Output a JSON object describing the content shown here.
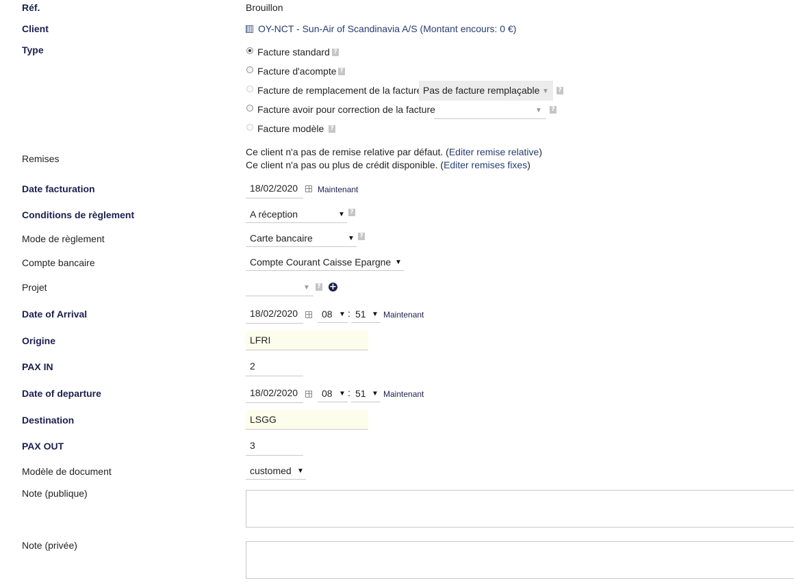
{
  "ref": {
    "label": "Réf.",
    "value": "Brouillon"
  },
  "client": {
    "label": "Client",
    "value": "OY-NCT - Sun-Air of Scandinavia A/S (Montant encours: 0 €)",
    "icon": "building-icon"
  },
  "type": {
    "label": "Type",
    "options": [
      {
        "label": "Facture standard",
        "selected": true
      },
      {
        "label": "Facture d'acompte"
      },
      {
        "label": "Facture de remplacement de la facture",
        "select_value": "Pas de facture remplaçable"
      },
      {
        "label": "Facture avoir pour correction de la facture",
        "select_value": ""
      },
      {
        "label": "Facture modèle"
      }
    ]
  },
  "remises": {
    "label": "Remises",
    "line1_text": "Ce client n'a pas de remise relative par défaut. (",
    "line1_link": "Editer remise relative",
    "line1_end": ")",
    "line2_text": "Ce client n'a pas ou plus de crédit disponible. (",
    "line2_link": "Editer remises fixes",
    "line2_end": ")"
  },
  "date_facturation": {
    "label": "Date facturation",
    "value": "18/02/2020",
    "now": "Maintenant"
  },
  "conditions": {
    "label": "Conditions de règlement",
    "value": "A réception"
  },
  "mode": {
    "label": "Mode de règlement",
    "value": "Carte bancaire"
  },
  "compte": {
    "label": "Compte bancaire",
    "value": "Compte Courant Caisse Epargne"
  },
  "projet": {
    "label": "Projet",
    "value": ""
  },
  "arrival": {
    "label": "Date of Arrival",
    "date": "18/02/2020",
    "hour": "08",
    "minute": "51",
    "sep": ":",
    "now": "Maintenant"
  },
  "origine": {
    "label": "Origine",
    "value": "LFRI"
  },
  "pax_in": {
    "label": "PAX IN",
    "value": "2"
  },
  "departure": {
    "label": "Date of departure",
    "date": "18/02/2020",
    "hour": "08",
    "minute": "51",
    "sep": ":",
    "now": "Maintenant"
  },
  "destination": {
    "label": "Destination",
    "value": "LSGG"
  },
  "pax_out": {
    "label": "PAX OUT",
    "value": "3"
  },
  "modele": {
    "label": "Modèle de document",
    "value": "customed"
  },
  "note_publique": {
    "label": "Note (publique)"
  },
  "note_privee": {
    "label": "Note (privée)"
  },
  "symbols": {
    "help": "?",
    "dropdown": "▼",
    "plus": "+"
  }
}
